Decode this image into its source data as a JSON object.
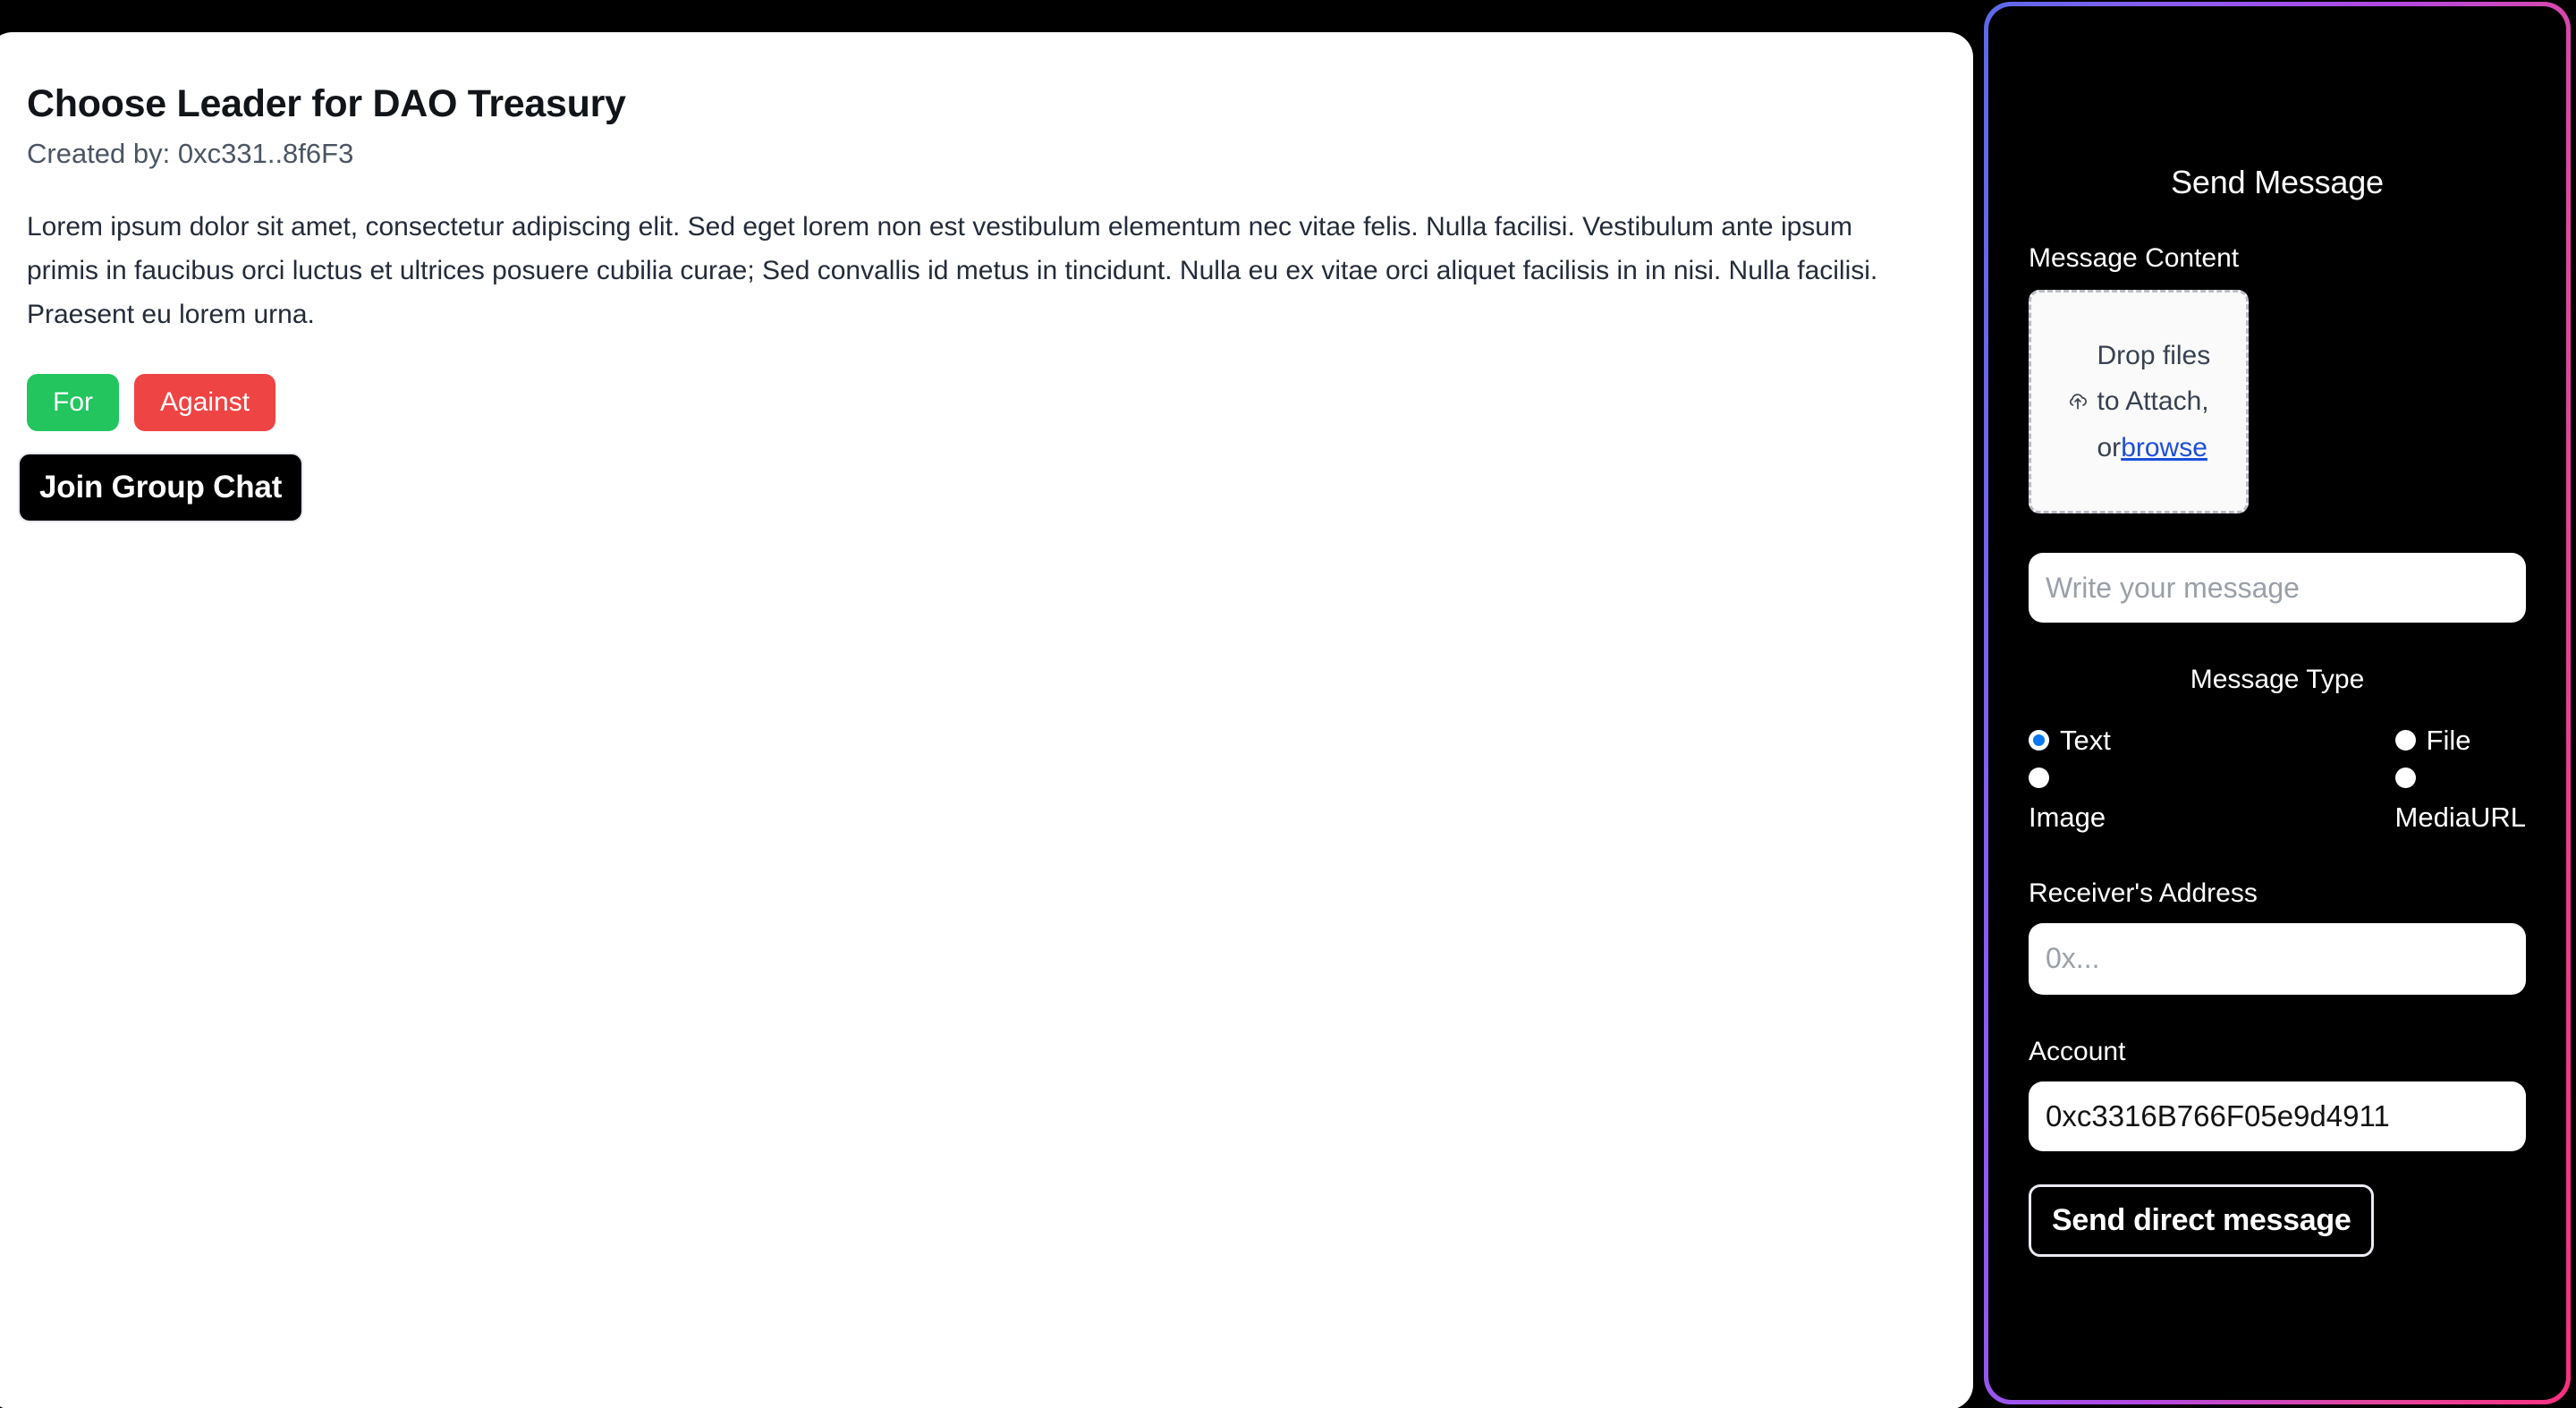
{
  "proposal": {
    "title": "Choose Leader for DAO Treasury",
    "created_by": "Created by: 0xc331..8f6F3",
    "body": "Lorem ipsum dolor sit amet, consectetur adipiscing elit. Sed eget lorem non est vestibulum elementum nec vitae felis. Nulla facilisi. Vestibulum ante ipsum primis in faucibus orci luctus et ultrices posuere cubilia curae; Sed convallis id metus in tincidunt. Nulla eu ex vitae orci aliquet facilisis in in nisi. Nulla facilisi. Praesent eu lorem urna.",
    "vote_for_label": "For",
    "vote_against_label": "Against",
    "join_chat_label": "Join Group Chat",
    "colors": {
      "for": "#22c55e",
      "against": "#ef4444",
      "join": "#000000"
    }
  },
  "send_message": {
    "panel_title": "Send Message",
    "message_content_label": "Message Content",
    "dropzone": {
      "icon": "cloud-upload-icon",
      "line1": "Drop files",
      "line2": "to Attach,",
      "line3_prefix": "or",
      "browse_label": "browse"
    },
    "message_input_placeholder": "Write your message",
    "message_input_value": "",
    "message_type_label": "Message Type",
    "message_type_options": [
      {
        "label": "Text",
        "selected": true
      },
      {
        "label": "File",
        "selected": false
      },
      {
        "label": "Image",
        "selected": false
      },
      {
        "label": "MediaURL",
        "selected": false
      }
    ],
    "receiver_label": "Receiver's Address",
    "receiver_placeholder": "0x...",
    "receiver_value": "",
    "account_label": "Account",
    "account_value": "0xc3316B766F05e9d4911",
    "send_button_label": "Send direct message",
    "colors": {
      "border_gradient_start": "#5b6ae8",
      "border_gradient_mid": "#b548e0",
      "border_gradient_end": "#f8307f",
      "radio_selected": "#0b78f0",
      "browse_link": "#1d4ed8",
      "panel_bg": "#000000"
    }
  }
}
